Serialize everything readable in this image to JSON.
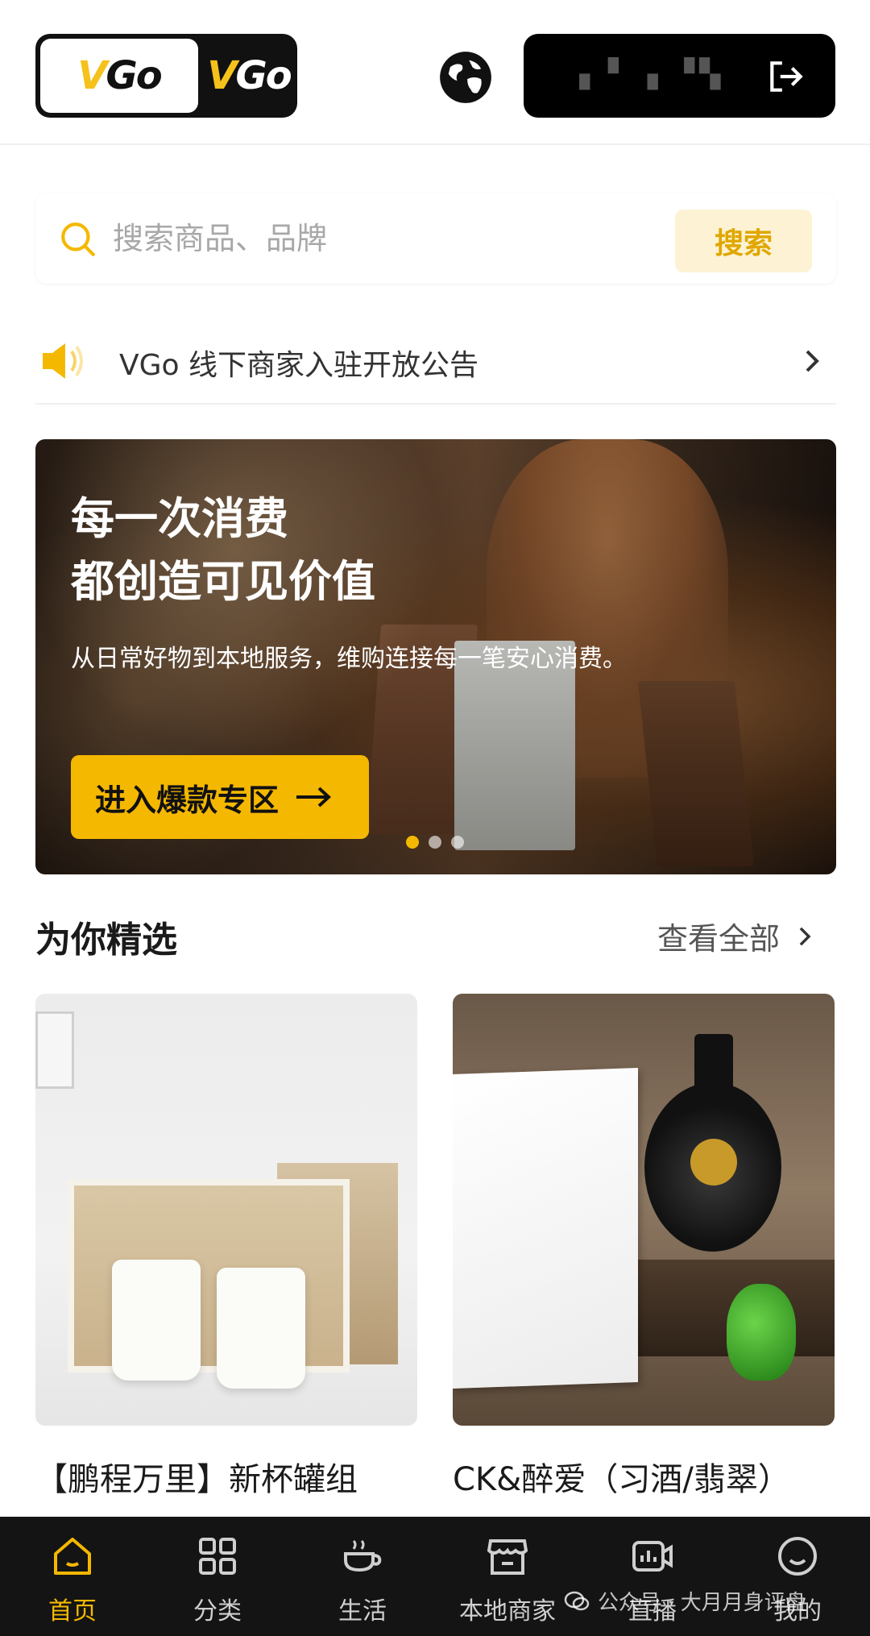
{
  "header": {
    "logo_text_v": "V",
    "logo_text_go": "Go",
    "account_name": "▗ ▘ ▖▝▚",
    "logout_icon": "logout-icon",
    "globe_icon": "globe-icon"
  },
  "search": {
    "placeholder": "搜索商品、品牌",
    "button_label": "搜索"
  },
  "notice": {
    "text": "VGo 线下商家入驻开放公告"
  },
  "banner": {
    "title_line1": "每一次消费",
    "title_line2": "都创造可见价值",
    "subtitle": "从日常好物到本地服务，维购连接每一笔安心消费。",
    "cta_label": "进入爆款专区",
    "slides": 3,
    "active_slide": 1
  },
  "featured": {
    "title": "为你精选",
    "view_all": "查看全部",
    "products": [
      {
        "name": "【鹏程万里】新杯罐组"
      },
      {
        "name": "CK&醉爱（习酒/翡翠）"
      }
    ]
  },
  "bottom_nav": {
    "items": [
      {
        "label": "首页",
        "icon": "home-icon",
        "active": true
      },
      {
        "label": "分类",
        "icon": "grid-icon",
        "active": false
      },
      {
        "label": "生活",
        "icon": "cup-icon",
        "active": false
      },
      {
        "label": "本地商家",
        "icon": "shop-icon",
        "active": false
      },
      {
        "label": "直播",
        "icon": "video-icon",
        "active": false
      },
      {
        "label": "我的",
        "icon": "profile-icon",
        "active": false
      }
    ]
  },
  "watermark": {
    "text": "公众号 · 大月月身评盘"
  },
  "colors": {
    "accent": "#f5b800",
    "nav_bg": "#141414"
  }
}
